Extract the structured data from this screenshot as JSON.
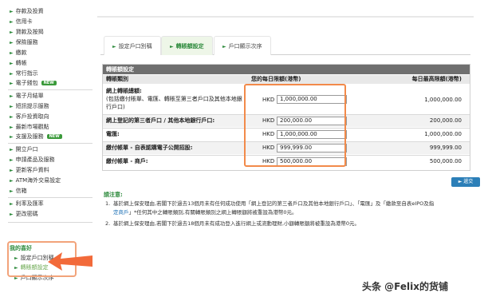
{
  "sidebar": {
    "items": [
      {
        "label": "存款及投資"
      },
      {
        "label": "信用卡"
      },
      {
        "label": "貸款及按揭"
      },
      {
        "label": "保險服務"
      },
      {
        "label": "繳款"
      },
      {
        "label": "轉帳"
      },
      {
        "label": "常行指示"
      },
      {
        "label": "電子錢包",
        "badge": "NEW"
      },
      {
        "label": "電子月結單"
      },
      {
        "label": "短訊提示服務"
      },
      {
        "label": "客戶投資取向"
      },
      {
        "label": "最新市場觀點"
      },
      {
        "label": "支援及服務",
        "badge": "NEW"
      },
      {
        "label": "開立戶口"
      },
      {
        "label": "申請產品及服務"
      },
      {
        "label": "更新客戶資料"
      },
      {
        "label": "ATM海外交易設定"
      },
      {
        "label": "信箱"
      },
      {
        "label": "利率及匯率"
      },
      {
        "label": "更改密碼"
      }
    ],
    "group_title": "我的喜好",
    "sub_items": [
      {
        "label": "設定戶口別稱"
      },
      {
        "label": "轉賬額設定"
      },
      {
        "label": "戶口顯示次序"
      }
    ]
  },
  "tabs": [
    {
      "label": "設定戶口別稱"
    },
    {
      "label": "轉賬額設定"
    },
    {
      "label": "戶口顯示次序"
    }
  ],
  "panel": {
    "title": "轉賬額設定",
    "headers": {
      "type": "轉賬類別",
      "daily": "您的每日限額(港幣)",
      "max": "每日最高限額(港幣)"
    },
    "rows": [
      {
        "type_lines": [
          "網上轉賬總額:",
          "(包括繳付賬單、電匯、轉賬至第三者戶口及其他本地銀",
          "行戶口)"
        ],
        "currency": "HKD",
        "value": "1,000,000.00",
        "max": "1,000,000.00"
      },
      {
        "type_lines": [
          "網上登記的第三者戶口 / 其他本地銀行戶口:"
        ],
        "currency": "HKD",
        "value": "200,000.00",
        "max": "200,000.00"
      },
      {
        "type_lines": [
          "電匯:"
        ],
        "currency": "HKD",
        "value": "1,000,000.00",
        "max": "1,000,000.00"
      },
      {
        "type_lines": [
          "繳付帳單 - 自表認購電子公開招股:"
        ],
        "currency": "HKD",
        "value": "999,999.00",
        "max": "999,999.00"
      },
      {
        "type_lines": [
          "繳付帳單 - 商戶:"
        ],
        "currency": "HKD",
        "value": "500,000.00",
        "max": "500,000.00"
      }
    ]
  },
  "submit_label": "遞交",
  "notes": {
    "title": "請注意:",
    "items": [
      {
        "num": "1.",
        "line1": "基於網上保安理由,若閣下於過去13個月未有任何成功使用「網上登記的第三者戶口及其他本地銀行戶口」、「電匯」及「繳款至自表eIPO及指",
        "line2_link": "定商戶",
        "line2_rest": "」*任何其中之轉賬類別,有關轉賬類別之網上轉賬額將被重設為港幣0元。"
      },
      {
        "num": "2.",
        "line1": "基於網上保安理由,若閣下於過去18個月未有成功登入進行網上或流動理財,小額轉賬額將被重設為港幣0元。"
      }
    ]
  },
  "watermark": "头条 @Felix的货铺",
  "colors": {
    "accent_green": "#2e8b3d",
    "highlight_orange": "#f28a4a",
    "submit_blue": "#2c7fb8"
  }
}
